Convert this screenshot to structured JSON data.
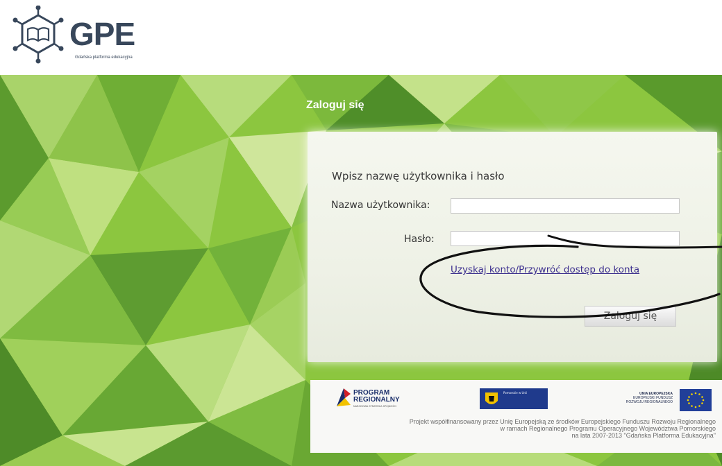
{
  "header": {
    "logo_text": "GPE",
    "logo_subtitle": "Gdańska platforma edukacyjna"
  },
  "login": {
    "title": "Zaloguj się",
    "heading": "Wpisz nazwę użytkownika i hasło",
    "username_label": "Nazwa użytkownika:",
    "username_value": "",
    "password_label": "Hasło:",
    "password_value": "",
    "account_link": "Uzyskaj konto/Przywróć dostęp do konta",
    "submit_label": "Zaloguj się"
  },
  "footer": {
    "program_logo_line1": "PROGRAM",
    "program_logo_line2": "REGIONALNY",
    "program_logo_sub": "NARODOWA STRATEGIA SPÓJNOŚCI",
    "pomorskie_logo_text": "Pomorskie w Unii",
    "eu_logo_line1": "UNIA EUROPEJSKA",
    "eu_logo_line2": "EUROPEJSKI FUNDUSZ",
    "eu_logo_line3": "ROZWOJU REGIONALNEGO",
    "text_line1": "Projekt współfinansowany przez Unię Europejską ze środków Europejskiego Funduszu Rozwoju Regionalnego",
    "text_line2": "w ramach Regionalnego Programu Operacyjnego Województwa Pomorskiego",
    "text_line3": "na lata 2007-2013 \"Gdańska Platforma Edukacyjna\""
  },
  "colors": {
    "logo": "#38475b",
    "link": "#3c2f8e",
    "background_green": "#8cc63f"
  }
}
